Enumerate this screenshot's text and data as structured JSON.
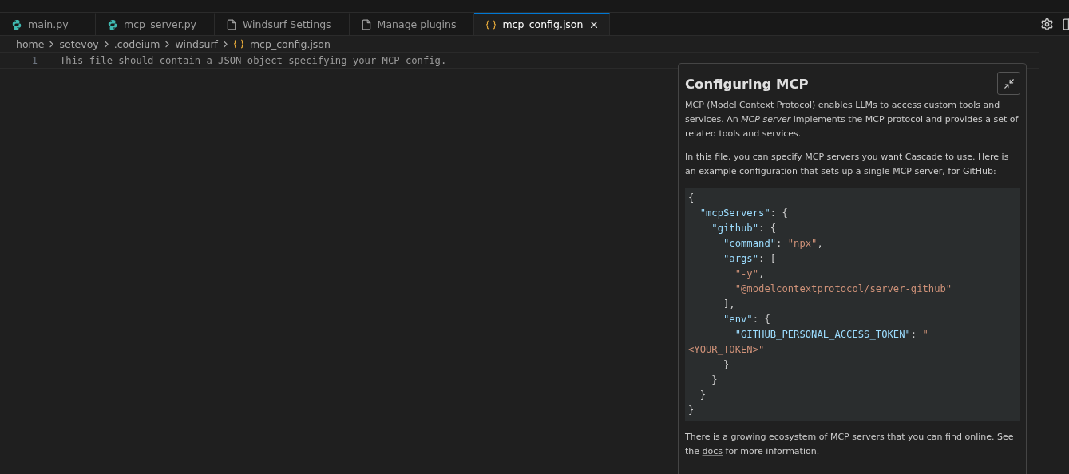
{
  "tabs": [
    {
      "label": "main.py",
      "kind": "python",
      "selected": false,
      "closable": false
    },
    {
      "label": "mcp_server.py",
      "kind": "python",
      "selected": false,
      "closable": false
    },
    {
      "label": "Windsurf Settings",
      "kind": "file",
      "selected": false,
      "closable": false
    },
    {
      "label": "Manage plugins",
      "kind": "file",
      "selected": false,
      "closable": false
    },
    {
      "label": "mcp_config.json",
      "kind": "json",
      "selected": true,
      "closable": true
    }
  ],
  "breadcrumb": [
    {
      "label": "home",
      "kind": "folder"
    },
    {
      "label": "setevoy",
      "kind": "folder"
    },
    {
      "label": ".codeium",
      "kind": "folder"
    },
    {
      "label": "windsurf",
      "kind": "folder"
    },
    {
      "label": "mcp_config.json",
      "kind": "json"
    }
  ],
  "editor": {
    "lines": [
      {
        "number": "1",
        "text": "This file should contain a JSON object specifying your MCP config."
      }
    ]
  },
  "panel": {
    "title": "Configuring MCP",
    "paragraphs": [
      "MCP (Model Context Protocol) enables LLMs to access custom tools and services. An *MCP server* implements the MCP protocol and provides a set of related tools and services.",
      "In this file, you can specify MCP servers you want Cascade to use. Here is an example configuration that sets up a single MCP server, for GitHub:"
    ],
    "code": [
      [
        {
          "kind": "punct",
          "text": "{"
        }
      ],
      [
        {
          "kind": "key",
          "text": "  \"mcpServers\""
        },
        {
          "kind": "punct",
          "text": ": {"
        }
      ],
      [
        {
          "kind": "key",
          "text": "    \"github\""
        },
        {
          "kind": "punct",
          "text": ": {"
        }
      ],
      [
        {
          "kind": "key",
          "text": "      \"command\""
        },
        {
          "kind": "punct",
          "text": ": "
        },
        {
          "kind": "string",
          "text": "\"npx\""
        },
        {
          "kind": "punct",
          "text": ","
        }
      ],
      [
        {
          "kind": "key",
          "text": "      \"args\""
        },
        {
          "kind": "punct",
          "text": ": ["
        }
      ],
      [
        {
          "kind": "string",
          "text": "        \"-y\""
        },
        {
          "kind": "punct",
          "text": ","
        }
      ],
      [
        {
          "kind": "string",
          "text": "        \"@modelcontextprotocol/server-github\""
        }
      ],
      [
        {
          "kind": "punct",
          "text": "      ],"
        }
      ],
      [
        {
          "kind": "key",
          "text": "      \"env\""
        },
        {
          "kind": "punct",
          "text": ": {"
        }
      ],
      [
        {
          "kind": "key",
          "text": "        \"GITHUB_PERSONAL_ACCESS_TOKEN\""
        },
        {
          "kind": "punct",
          "text": ": "
        },
        {
          "kind": "string",
          "text": "\""
        }
      ],
      [
        {
          "kind": "string",
          "text": "<YOUR_TOKEN>\""
        }
      ],
      [
        {
          "kind": "punct",
          "text": "      }"
        }
      ],
      [
        {
          "kind": "punct",
          "text": "    }"
        }
      ],
      [
        {
          "kind": "punct",
          "text": "  }"
        }
      ],
      [
        {
          "kind": "punct",
          "text": "}"
        }
      ]
    ],
    "footer": [
      {
        "kind": "text",
        "text": "There is a growing ecosystem of MCP servers that you can find online. See the "
      },
      {
        "kind": "link",
        "text": "docs"
      },
      {
        "kind": "text",
        "text": " for more information."
      }
    ]
  }
}
